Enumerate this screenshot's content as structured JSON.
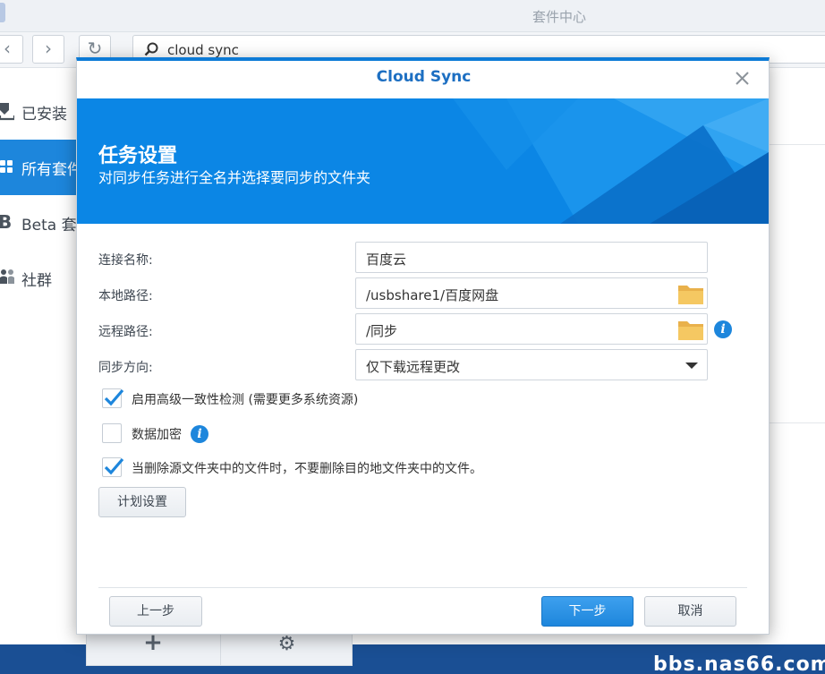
{
  "app": {
    "title": "套件中心",
    "search_value": "cloud sync",
    "nav_back": "‹",
    "nav_forward": "›",
    "refresh": "↻"
  },
  "sidebar": {
    "items": [
      {
        "label": "已安装",
        "icon": "download-icon"
      },
      {
        "label": "所有套件",
        "icon": "grid-icon",
        "active": true
      },
      {
        "label": "Beta 套件",
        "icon": "beta-icon"
      },
      {
        "label": "社群",
        "icon": "community-icon"
      }
    ]
  },
  "bottom_bar": {
    "add": "+",
    "settings": "⚙"
  },
  "desktop_text": "bbs.nas66.com",
  "dialog": {
    "title": "Cloud Sync",
    "banner_title": "任务设置",
    "banner_subtitle": "对同步任务进行全名并选择要同步的文件夹",
    "fields": {
      "connection_name_label": "连接名称:",
      "connection_name_value": "百度云",
      "local_path_label": "本地路径:",
      "local_path_value": "/usbshare1/百度网盘",
      "remote_path_label": "远程路径:",
      "remote_path_value": "/同步",
      "sync_direction_label": "同步方向:",
      "sync_direction_value": "仅下载远程更改"
    },
    "checks": [
      {
        "label": "启用高级一致性检测 (需要更多系统资源)",
        "checked": true
      },
      {
        "label": "数据加密",
        "checked": false
      },
      {
        "label": "当删除源文件夹中的文件时，不要删除目的地文件夹中的文件。",
        "checked": true
      }
    ],
    "schedule_button": "计划设置",
    "prev_button": "上一步",
    "next_button": "下一步",
    "cancel_button": "取消"
  },
  "colors": {
    "accent": "#1d86dc",
    "banner": "#0b86e5",
    "folder": "#f2c15a"
  }
}
